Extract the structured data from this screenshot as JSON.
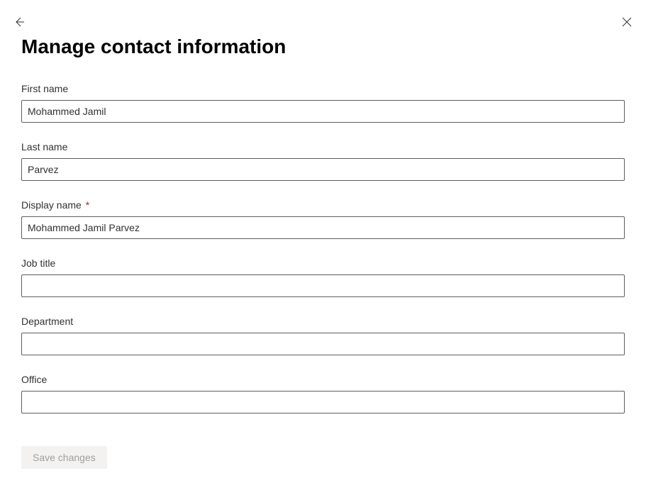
{
  "page": {
    "title": "Manage contact information"
  },
  "form": {
    "first_name": {
      "label": "First name",
      "value": "Mohammed Jamil"
    },
    "last_name": {
      "label": "Last name",
      "value": "Parvez"
    },
    "display_name": {
      "label": "Display name",
      "value": "Mohammed Jamil Parvez",
      "required": true
    },
    "job_title": {
      "label": "Job title",
      "value": ""
    },
    "department": {
      "label": "Department",
      "value": ""
    },
    "office": {
      "label": "Office",
      "value": ""
    }
  },
  "actions": {
    "save_label": "Save changes"
  },
  "icons": {
    "required_marker": "*"
  }
}
